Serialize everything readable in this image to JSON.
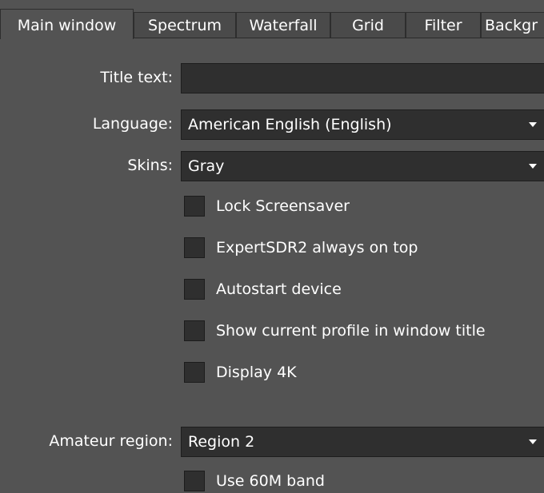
{
  "tabs": [
    {
      "label": "Main window"
    },
    {
      "label": "Spectrum"
    },
    {
      "label": "Waterfall"
    },
    {
      "label": "Grid"
    },
    {
      "label": "Filter"
    },
    {
      "label": "Backgr"
    }
  ],
  "form": {
    "title_text": {
      "label": "Title text:",
      "value": ""
    },
    "language": {
      "label": "Language:",
      "value": "American English (English)"
    },
    "skins": {
      "label": "Skins:",
      "value": "Gray"
    },
    "checkboxes": [
      {
        "label": "Lock Screensaver",
        "checked": false
      },
      {
        "label": "ExpertSDR2 always on top",
        "checked": false
      },
      {
        "label": "Autostart device",
        "checked": false
      },
      {
        "label": "Show current profile in window title",
        "checked": false
      },
      {
        "label": "Display 4K",
        "checked": false
      }
    ],
    "amateur_region": {
      "label": "Amateur region:",
      "value": "Region 2"
    },
    "use_60m": {
      "label": "Use 60M band",
      "checked": false
    }
  },
  "icons": {
    "dropdown": "chevron-down-icon"
  },
  "colors": {
    "background": "#535353",
    "field": "#2f2f2f",
    "text": "#ffffff"
  }
}
